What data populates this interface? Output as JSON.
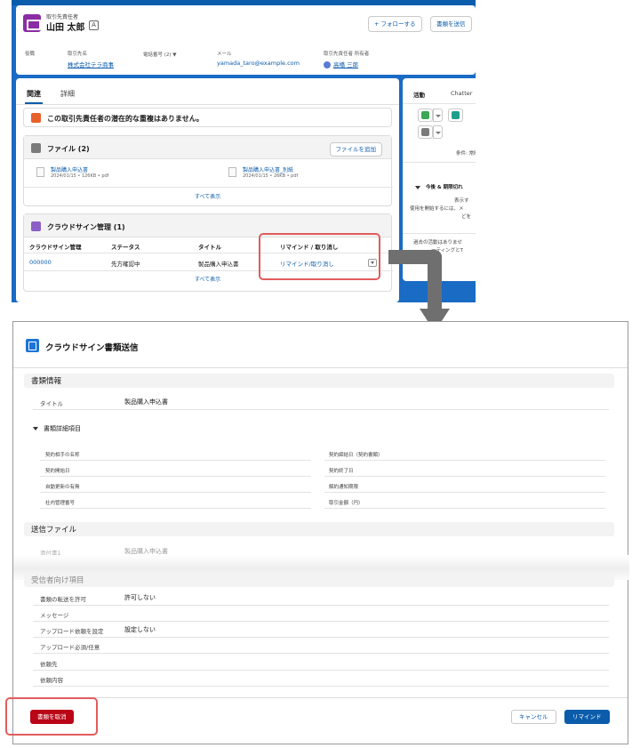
{
  "top": {
    "record_type": "取引先責任者",
    "record_name": "山田 太郎",
    "badge": "A",
    "follow_btn": "+ フォローする",
    "send_doc_btn": "書類を送信",
    "fields": [
      {
        "label": "役職",
        "value": ""
      },
      {
        "label": "取引先名",
        "value": "株式会社テラ商事"
      },
      {
        "label": "電話番号 (2) ▼",
        "value": ""
      },
      {
        "label": "メール",
        "value": "yamada_taro@example.com"
      },
      {
        "label": "取引先責任者 所有者",
        "value": "高橋 三郎"
      }
    ],
    "tabs": [
      "関連",
      "詳細"
    ],
    "duplicate_notice": "この取引先責任者の潜在的な重複はありません。",
    "files": {
      "title": "ファイル (2)",
      "add_btn": "ファイルを追加",
      "items": [
        {
          "name": "製品購入申込書",
          "meta": "2024/01/15 • 126KB • pdf"
        },
        {
          "name": "製品購入申込書_別紙",
          "meta": "2024/01/15 • 26KB • pdf"
        }
      ],
      "show_all": "すべて表示"
    },
    "cloudsign": {
      "title": "クラウドサイン管理 (1)",
      "headers": [
        "クラウドサイン管理",
        "ステータス",
        "タイトル",
        "リマインド / 取り消し"
      ],
      "row": [
        "000000",
        "先方確認中",
        "製品購入申込書",
        "リマインド/取り消し"
      ],
      "show_all": "すべて表示"
    },
    "side": {
      "tabs": [
        "活動",
        "Chatter"
      ],
      "filter": "条件: 常時",
      "upcoming": "今後 & 期限切れ",
      "empty1": "表示す",
      "empty2": "使用を開始するには、メ",
      "empty3": "どを",
      "past1": "過去の活動はありませ",
      "past2": "ーティングとT"
    }
  },
  "modal": {
    "title": "クラウドサイン書類送信",
    "sections": {
      "doc_info": "書類情報",
      "send_files": "送信ファイル",
      "recipient": "受信者向け項目"
    },
    "title_label": "タイトル",
    "title_value": "製品購入申込書",
    "detail_toggle": "書類詳細項目",
    "detail_fields_left": [
      "契約相手の名称",
      "契約開始日",
      "自動更新の有無",
      "社内管理番号"
    ],
    "detail_fields_right": [
      "契約締結日（契約書類）",
      "契約終了日",
      "解約通知期限",
      "取引金額（円）"
    ],
    "attachment_label": "添付書1",
    "attachment_value": "製品購入申込書",
    "recipient_fields": [
      {
        "label": "書類の転送を許可",
        "value": "許可しない"
      },
      {
        "label": "メッセージ",
        "value": ""
      },
      {
        "label": "アップロード依頼を設定",
        "value": "設定しない"
      },
      {
        "label": "アップロード必須/任意",
        "value": ""
      },
      {
        "label": "依頼先",
        "value": ""
      },
      {
        "label": "依頼内容",
        "value": ""
      }
    ],
    "cancel_doc_btn": "書類を取消",
    "cancel_btn": "キャンセル",
    "remind_btn": "リマインド"
  },
  "colors": {
    "brand": "#0b5cab",
    "danger": "#ba0517",
    "highlight": "#e25c5c",
    "arrow": "#6f6f6f"
  }
}
